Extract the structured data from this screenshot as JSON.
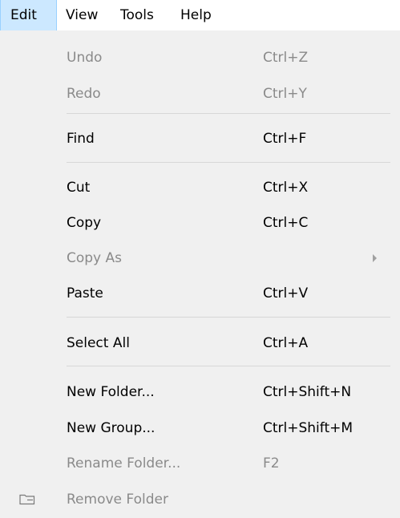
{
  "menubar": {
    "items": [
      {
        "label": "Edit"
      },
      {
        "label": "View"
      },
      {
        "label": "Tools"
      },
      {
        "label": "Help"
      }
    ]
  },
  "menu": {
    "items": [
      {
        "label": "Undo",
        "shortcut": "Ctrl+Z",
        "enabled": false
      },
      {
        "label": "Redo",
        "shortcut": "Ctrl+Y",
        "enabled": false
      },
      {
        "label": "Find",
        "shortcut": "Ctrl+F",
        "enabled": true
      },
      {
        "label": "Cut",
        "shortcut": "Ctrl+X",
        "enabled": true
      },
      {
        "label": "Copy",
        "shortcut": "Ctrl+C",
        "enabled": true
      },
      {
        "label": "Copy As",
        "shortcut": "",
        "enabled": false,
        "submenu": true
      },
      {
        "label": "Paste",
        "shortcut": "Ctrl+V",
        "enabled": true
      },
      {
        "label": "Select All",
        "shortcut": "Ctrl+A",
        "enabled": true
      },
      {
        "label": "New Folder...",
        "shortcut": "Ctrl+Shift+N",
        "enabled": true
      },
      {
        "label": "New Group...",
        "shortcut": "Ctrl+Shift+M",
        "enabled": true
      },
      {
        "label": "Rename Folder...",
        "shortcut": "F2",
        "enabled": false
      },
      {
        "label": "Remove Folder",
        "shortcut": "",
        "enabled": false,
        "icon": "folder-remove-icon"
      }
    ]
  },
  "colors": {
    "menu_background": "#f0f0f0",
    "active_menubar_background": "#cce8ff",
    "disabled_text": "#8a8a8a",
    "separator": "#d7d7d7"
  }
}
